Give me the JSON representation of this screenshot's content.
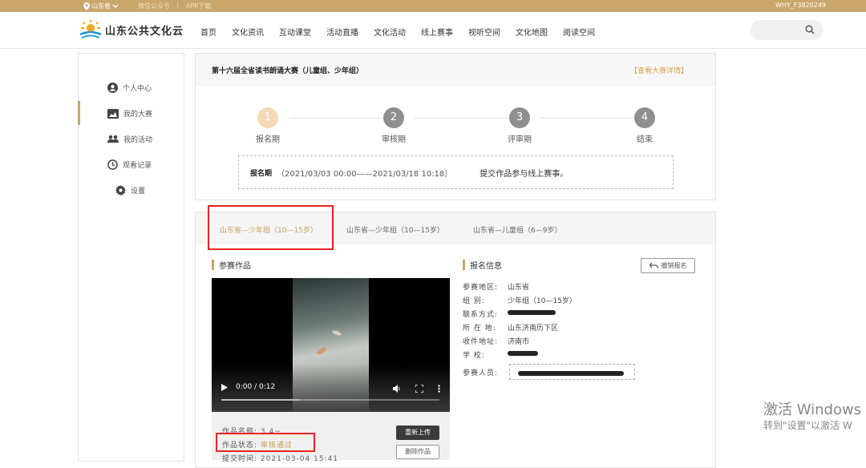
{
  "topbar": {
    "location": "山东省",
    "wechat": "微信公众号",
    "separator": "|",
    "app": "APP下载",
    "user": "WHY_F3820249"
  },
  "nav": {
    "brand": "山东公共文化云",
    "items": [
      "首页",
      "文化资讯",
      "互动课堂",
      "活动直播",
      "文化活动",
      "线上赛事",
      "视听空间",
      "文化地图",
      "阅读空间"
    ]
  },
  "sidebar": {
    "items": [
      {
        "label": "个人中心",
        "icon": "user-icon"
      },
      {
        "label": "我的大赛",
        "icon": "image-icon"
      },
      {
        "label": "我的活动",
        "icon": "people-icon"
      },
      {
        "label": "观看记录",
        "icon": "clock-icon"
      },
      {
        "label": "设置",
        "icon": "gear-icon"
      }
    ],
    "active_index": 1
  },
  "contest": {
    "title": "第十六届全省读书朗诵大赛（儿童组、少年组）",
    "detail_link": "【查看大赛详情】",
    "steps": [
      {
        "num": "1",
        "label": "报名期"
      },
      {
        "num": "2",
        "label": "审核期"
      },
      {
        "num": "3",
        "label": "评审期"
      },
      {
        "num": "4",
        "label": "结束"
      }
    ],
    "active_step": 1,
    "period_label": "报名期",
    "period_range": "（2021/03/03 00:00——2021/03/18 10:18）",
    "period_desc": "提交作品参与线上赛事。"
  },
  "tabs": [
    {
      "label": "山东省—少年组（10—15岁）",
      "active": true
    },
    {
      "label": "山东省—少年组（10—15岁）",
      "active": false
    },
    {
      "label": "山东省—儿童组（6—9岁）",
      "active": false
    }
  ],
  "works": {
    "section_title": "参赛作品",
    "video_time": "0:00 / 0:12",
    "video_progress": 0.36,
    "name_key": "作品名称:",
    "name_value": "3.4~",
    "status_key": "作品状态:",
    "status_value": "审核通过",
    "time_key": "提交时间:",
    "time_value": "2021-03-04 15:41",
    "reupload_button": "重新上传",
    "delete_button": "删除作品"
  },
  "registration": {
    "section_title": "报名信息",
    "withdraw_button": "撤销报名",
    "rows": [
      {
        "key": "参赛地区:",
        "value": "山东省"
      },
      {
        "key": "组 别:",
        "value": "少年组（10—15岁）"
      },
      {
        "key": "联系方式:",
        "value": ""
      },
      {
        "key": "所 在 地:",
        "value": "山东济南历下区"
      },
      {
        "key": "收件地址:",
        "value": "济南市"
      },
      {
        "key": "学 校:",
        "value": ""
      },
      {
        "key": "参赛人员:",
        "value": ""
      }
    ]
  },
  "watermark": {
    "line1": "激活 Windows",
    "line2": "转到\"设置\"以激活 W"
  },
  "colors": {
    "accent": "#c9a66b",
    "highlight": "#e8241c",
    "status_ok": "#c9a060"
  }
}
